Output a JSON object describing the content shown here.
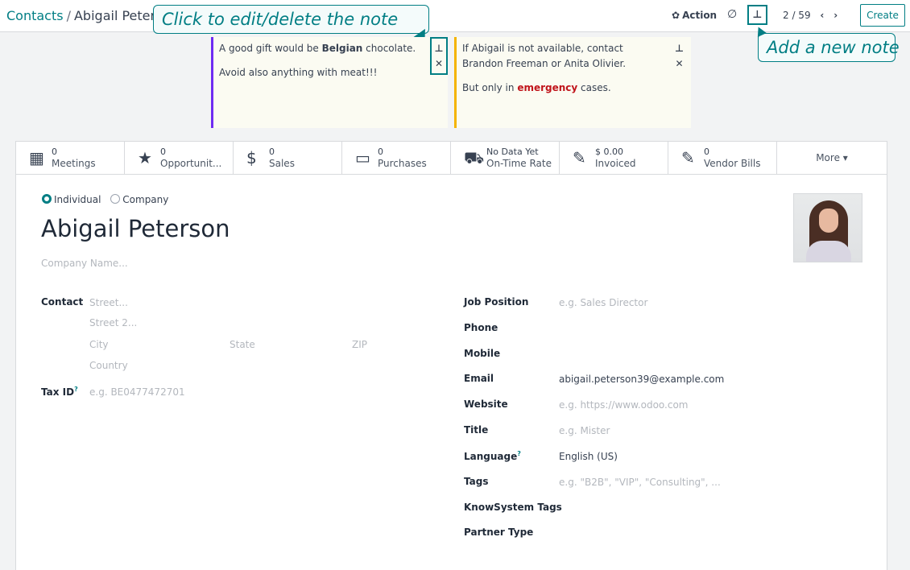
{
  "breadcrumb": {
    "root": "Contacts",
    "separator": "/",
    "current": "Abigail Peter"
  },
  "callouts": {
    "left": "Click to edit/delete the note",
    "right": "Add a new note"
  },
  "toolbar": {
    "action_label": "Action",
    "action_icon": "gear-icon",
    "discard_icon": "discard-icon",
    "note_icon": "pin-icon",
    "pager": "2 / 59",
    "create_label": "Create"
  },
  "notes": [
    {
      "line1_pre": "A good gift would be ",
      "line1_bold": "Belgian",
      "line1_post": " chocolate.",
      "line2": "Avoid also anything with meat!!!",
      "accent": "#6f2cf2"
    },
    {
      "line1": "If Abigail is not available, contact Brandon Freeman or Anita Olivier.",
      "line2_pre": "But only in ",
      "line2_red": "emergency",
      "line2_post": " cases.",
      "accent": "#f4b400"
    }
  ],
  "stats": [
    {
      "icon": "calendar-icon",
      "value": "0",
      "label": "Meetings"
    },
    {
      "icon": "star-icon",
      "value": "0",
      "label": "Opportunit..."
    },
    {
      "icon": "dollar-icon",
      "value": "0",
      "label": "Sales"
    },
    {
      "icon": "credit-card-icon",
      "value": "0",
      "label": "Purchases"
    },
    {
      "icon": "truck-icon",
      "value": "No Data Yet",
      "label": "On-Time Rate"
    },
    {
      "icon": "edit-icon",
      "value": "$ 0.00",
      "label": "Invoiced"
    },
    {
      "icon": "edit-icon",
      "value": "0",
      "label": "Vendor Bills"
    },
    {
      "label": "More ▾"
    }
  ],
  "partner": {
    "type_individual": "Individual",
    "type_company": "Company",
    "name": "Abigail Peterson",
    "company_placeholder": "Company Name..."
  },
  "address": {
    "label": "Contact",
    "street": "Street...",
    "street2": "Street 2...",
    "city": "City",
    "state": "State",
    "zip": "ZIP",
    "country": "Country",
    "tax_label": "Tax ID",
    "tax_placeholder": "e.g. BE0477472701"
  },
  "fields": {
    "job_position": {
      "label": "Job Position",
      "placeholder": "e.g. Sales Director"
    },
    "phone": {
      "label": "Phone"
    },
    "mobile": {
      "label": "Mobile"
    },
    "email": {
      "label": "Email",
      "value": "abigail.peterson39@example.com"
    },
    "website": {
      "label": "Website",
      "placeholder": "e.g. https://www.odoo.com"
    },
    "title": {
      "label": "Title",
      "placeholder": "e.g. Mister"
    },
    "language": {
      "label": "Language",
      "value": "English (US)"
    },
    "tags": {
      "label": "Tags",
      "placeholder": "e.g. \"B2B\", \"VIP\", \"Consulting\", ..."
    },
    "knowsystem_tags": {
      "label": "KnowSystem Tags"
    },
    "partner_type": {
      "label": "Partner Type"
    }
  },
  "colors": {
    "accent": "#017e84",
    "note_bg": "#fbfbf2",
    "emergency": "#c0141b"
  }
}
